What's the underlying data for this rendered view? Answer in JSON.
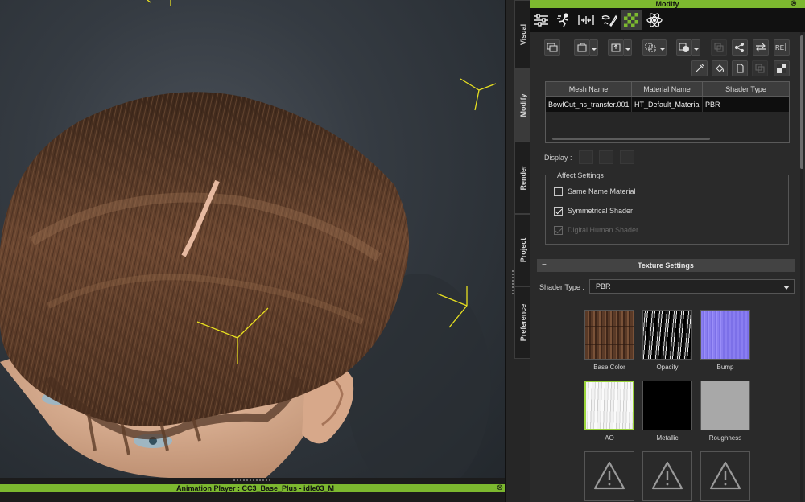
{
  "panel": {
    "title": "Modify",
    "close_glyph": "⊗"
  },
  "top_icons": [
    "sliders-icon",
    "motion-pose-icon",
    "morph-icon",
    "edit-facial-icon",
    "material-checker-icon",
    "physics-atom-icon"
  ],
  "side_tabs": [
    {
      "label": "Visual",
      "active": false
    },
    {
      "label": "Modify",
      "active": true
    },
    {
      "label": "Render",
      "active": false
    },
    {
      "label": "Project",
      "active": false
    },
    {
      "label": "Preference",
      "active": false
    }
  ],
  "mesh_table": {
    "headers": [
      "Mesh Name",
      "Material Name",
      "Shader Type"
    ],
    "rows": [
      [
        "BowlCut_hs_transfer.001",
        "HT_Default_Material",
        "PBR"
      ]
    ]
  },
  "display": {
    "label": "Display :"
  },
  "affect_settings": {
    "legend": "Affect Settings",
    "options": [
      {
        "label": "Same Name Material",
        "checked": false,
        "enabled": true
      },
      {
        "label": "Symmetrical Shader",
        "checked": true,
        "enabled": true
      },
      {
        "label": "Digital Human Shader",
        "checked": true,
        "enabled": false
      }
    ]
  },
  "texture_settings": {
    "collapse_glyph": "−",
    "title": "Texture Settings",
    "shader_type_label": "Shader Type :",
    "shader_type_value": "PBR",
    "slots": [
      {
        "label": "Base Color",
        "kind": "hair-wood"
      },
      {
        "label": "Opacity",
        "kind": "streaks"
      },
      {
        "label": "Bump",
        "kind": "normal-map"
      },
      {
        "label": "AO",
        "kind": "ao",
        "active": true
      },
      {
        "label": "Metallic",
        "kind": "black"
      },
      {
        "label": "Roughness",
        "kind": "gray"
      },
      {
        "label": "",
        "kind": "warning"
      },
      {
        "label": "",
        "kind": "warning"
      },
      {
        "label": "",
        "kind": "warning"
      }
    ]
  },
  "animation_player": {
    "title": "Animation Player : CC3_Base_Plus - idle03_M",
    "close_glyph": "⊗"
  },
  "colors": {
    "accent_green": "#7cb82f",
    "gizmo_yellow": "#e8e020",
    "hair_brown": "#5e3d28"
  }
}
